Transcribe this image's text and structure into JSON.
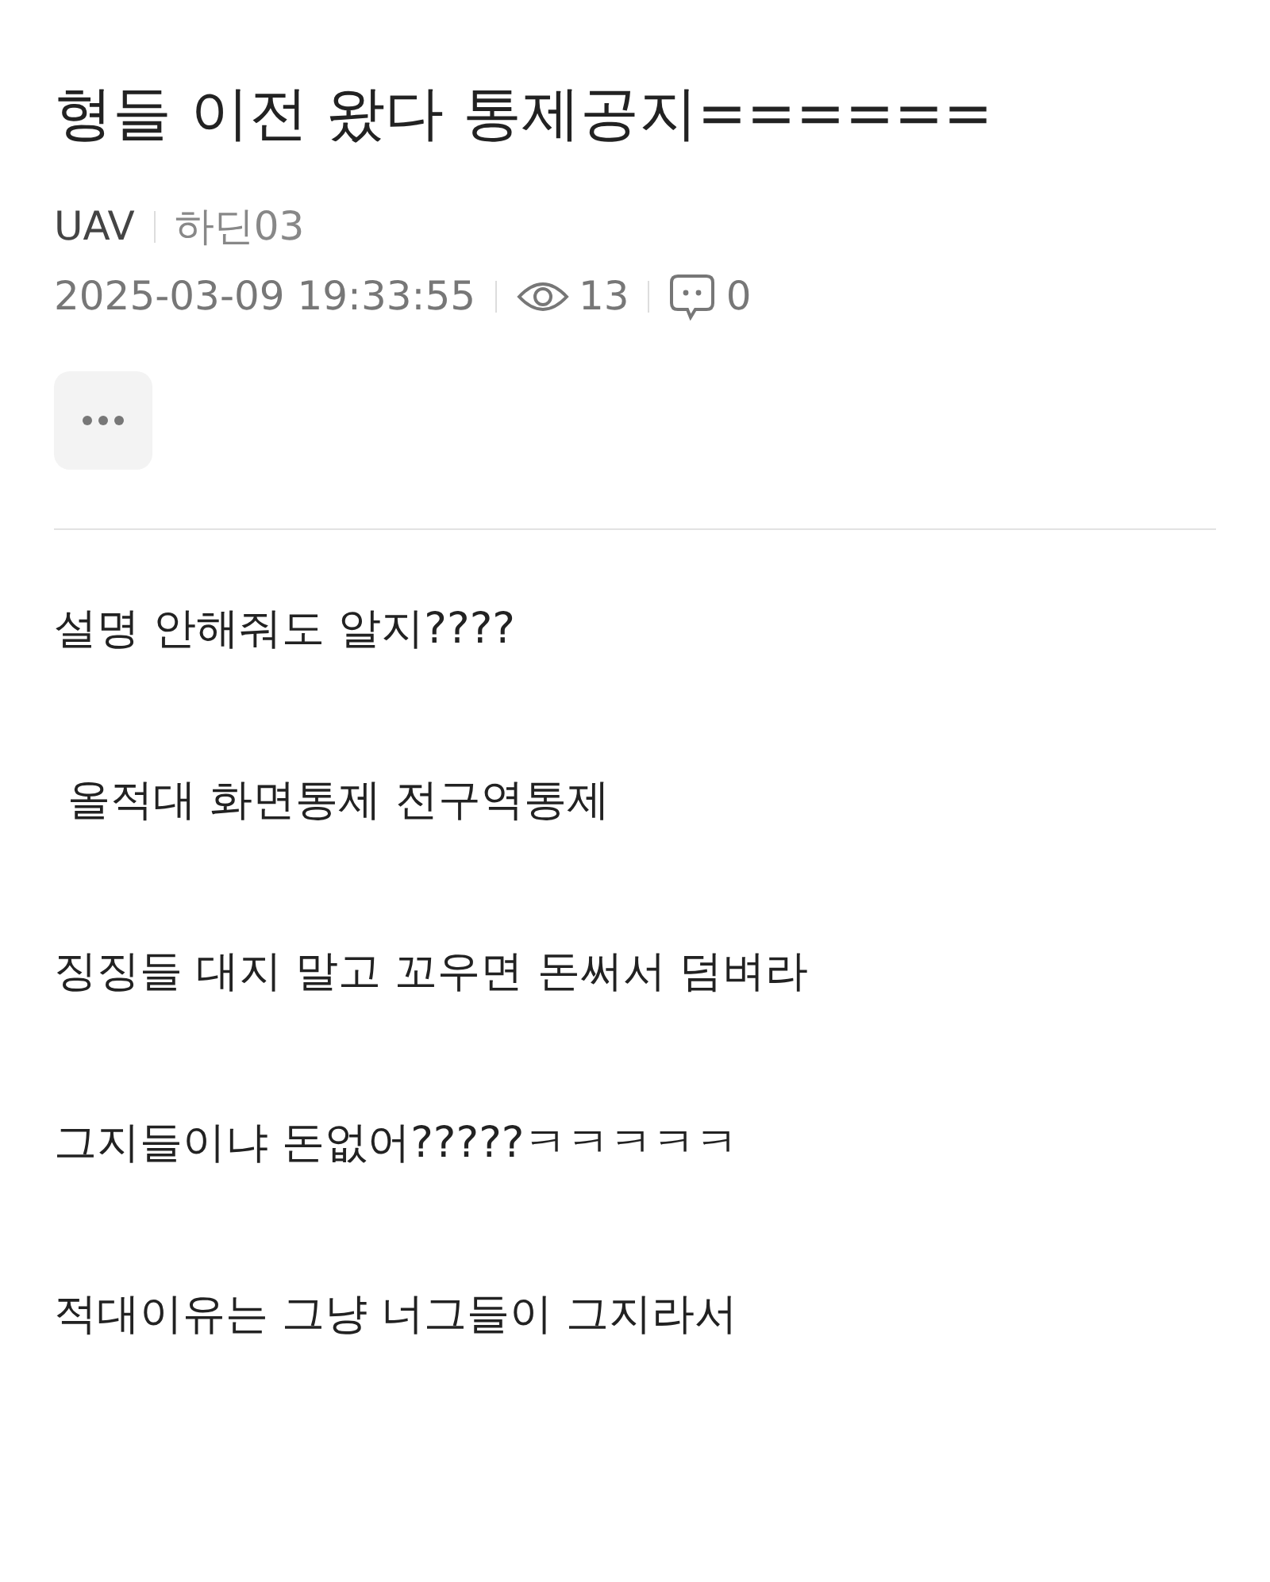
{
  "post": {
    "title": "형들 이전 왔다 통제공지======",
    "author": "UAV",
    "nickname": "하딘03",
    "date": "2025-03-09 19:33:55",
    "views": "13",
    "comments": "0",
    "paragraphs": [
      "설명 안해줘도 알지????",
      " 올적대 화면통제 전구역통제",
      "징징들 대지 말고 꼬우면 돈써서 덤벼라",
      "그지들이냐 돈없어?????ㅋㅋㅋㅋㅋ",
      "적대이유는 그냥 너그들이 그지라서"
    ]
  }
}
